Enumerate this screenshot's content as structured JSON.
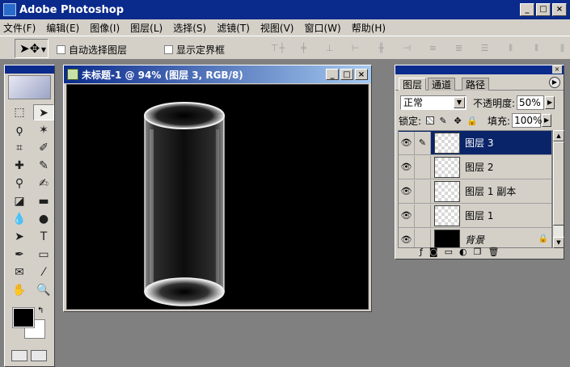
{
  "app": {
    "title": "Adobe Photoshop"
  },
  "window_buttons": {
    "minimize": "_",
    "maximize": "□",
    "close": "×"
  },
  "menu": [
    "文件(F)",
    "编辑(E)",
    "图像(I)",
    "图层(L)",
    "选择(S)",
    "滤镜(T)",
    "视图(V)",
    "窗口(W)",
    "帮助(H)"
  ],
  "options": {
    "auto_select_label": "自动选择图层",
    "show_bounds_label": "显示定界框",
    "auto_select_checked": false,
    "show_bounds_checked": false
  },
  "document": {
    "title": "未标题-1 @ 94% (图层 3, RGB/8)",
    "zoom": "94%",
    "active_layer": "图层 3",
    "mode": "RGB/8"
  },
  "layers_panel": {
    "tabs": [
      "图层",
      "通道",
      "路径"
    ],
    "active_tab": "图层",
    "blend_mode": "正常",
    "opacity_label": "不透明度:",
    "opacity_value": "50%",
    "lock_label": "锁定:",
    "fill_label": "填充:",
    "fill_value": "100%",
    "layers": [
      {
        "name": "图层 3",
        "selected": true,
        "visible": true,
        "thumb": "transparent"
      },
      {
        "name": "图层 2",
        "selected": false,
        "visible": true,
        "thumb": "transparent"
      },
      {
        "name": "图层 1 副本",
        "selected": false,
        "visible": true,
        "thumb": "transparent"
      },
      {
        "name": "图层 1",
        "selected": false,
        "visible": true,
        "thumb": "transparent"
      },
      {
        "name": "背景",
        "selected": false,
        "visible": true,
        "thumb": "black",
        "locked": true
      }
    ]
  },
  "colors": {
    "foreground": "#000000",
    "background": "#ffffff",
    "title_bar": "#0a2a8c",
    "selection": "#0a246a"
  }
}
